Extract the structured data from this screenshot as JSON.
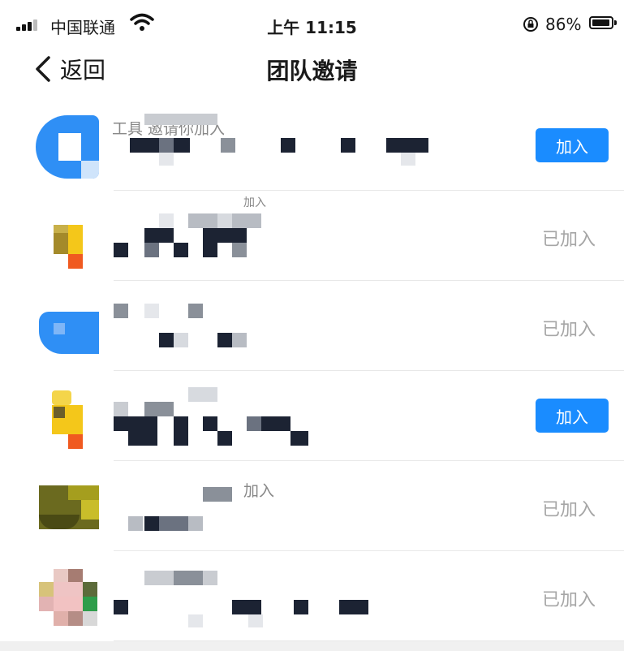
{
  "status_bar": {
    "carrier": "中国联通",
    "time": "上午 11:15",
    "battery": "86%",
    "icons": [
      "signal-icon",
      "wifi-icon",
      "rotation-lock-icon",
      "battery-icon"
    ]
  },
  "nav": {
    "back_label": "返回",
    "title": "团队邀请",
    "icons": [
      "chevron-left-icon"
    ]
  },
  "invites": [
    {
      "text": "工具 邀请你加入",
      "status": "join",
      "action_label": "加入"
    },
    {
      "text": "加入",
      "status": "joined",
      "action_label": "已加入"
    },
    {
      "text": "",
      "status": "joined",
      "action_label": "已加入"
    },
    {
      "text": "",
      "status": "join",
      "action_label": "加入"
    },
    {
      "text": "加入",
      "status": "joined",
      "action_label": "已加入"
    },
    {
      "text": "",
      "status": "joined",
      "action_label": "已加入"
    }
  ],
  "colors": {
    "accent": "#1a8cff",
    "joined_text": "#a6a6a6",
    "divider": "#e8e8e8"
  }
}
